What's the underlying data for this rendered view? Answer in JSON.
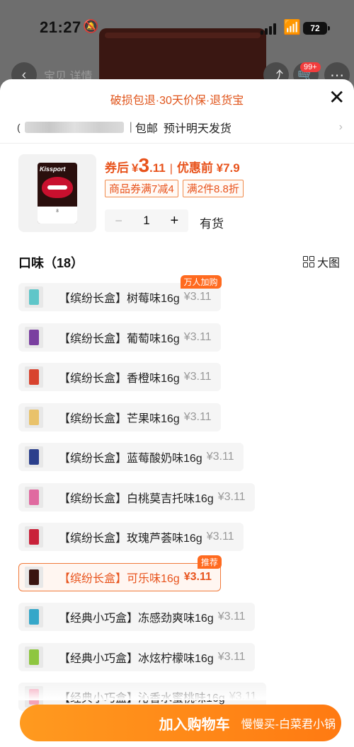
{
  "status_bar": {
    "time": "21:27",
    "battery": "72"
  },
  "background": {
    "title": "宝贝  详情",
    "cart_badge": "99+"
  },
  "sheet": {
    "promo_banner": "破损包退·30天价保·退货宝",
    "shipping": {
      "free_shipping": "包邮",
      "delivery": "预计明天发货"
    },
    "product": {
      "brand_on_image": "Kissport",
      "price_label": "券后",
      "currency": "¥",
      "price_integer": "3",
      "price_decimal": ".11",
      "original_price": "优惠前 ¥7.9",
      "coupons": [
        "商品券满7减4",
        "满2件8.8折"
      ],
      "quantity": "1",
      "stock_status": "有货"
    },
    "flavor_section": {
      "title": "口味（18）",
      "view_toggle": "大图"
    },
    "options": [
      {
        "name": "【缤纷长盒】树莓味16g",
        "price": "¥3.11",
        "tag": "万人加购",
        "color": "#5fc6c9"
      },
      {
        "name": "【缤纷长盒】葡萄味16g",
        "price": "¥3.11",
        "color": "#7a3fa0"
      },
      {
        "name": "【缤纷长盒】香橙味16g",
        "price": "¥3.11",
        "color": "#d8432e"
      },
      {
        "name": "【缤纷长盒】芒果味16g",
        "price": "¥3.11",
        "color": "#e9c26a"
      },
      {
        "name": "【缤纷长盒】蓝莓酸奶味16g",
        "price": "¥3.11",
        "color": "#2b3f8c"
      },
      {
        "name": "【缤纷长盒】白桃莫吉托味16g",
        "price": "¥3.11",
        "color": "#e06aa0"
      },
      {
        "name": "【缤纷长盒】玫瑰芦荟味16g",
        "price": "¥3.11",
        "color": "#c9223a"
      },
      {
        "name": "【缤纷长盒】可乐味16g",
        "price": "¥3.11",
        "tag": "推荐",
        "selected": true,
        "color": "#3a1410"
      },
      {
        "name": "【经典小巧盒】冻感劲爽味16g",
        "price": "¥3.11",
        "color": "#35a7c9"
      },
      {
        "name": "【经典小巧盒】冰炫柠檬味16g",
        "price": "¥3.11",
        "color": "#8ec63f"
      },
      {
        "name": "【经典小巧盒】沁香水蜜桃味16g",
        "price": "¥3.11",
        "color": "#f3a3b8"
      }
    ],
    "cart_button": {
      "label": "加入购物车",
      "sub": "慢慢买-白菜君小锅"
    }
  }
}
